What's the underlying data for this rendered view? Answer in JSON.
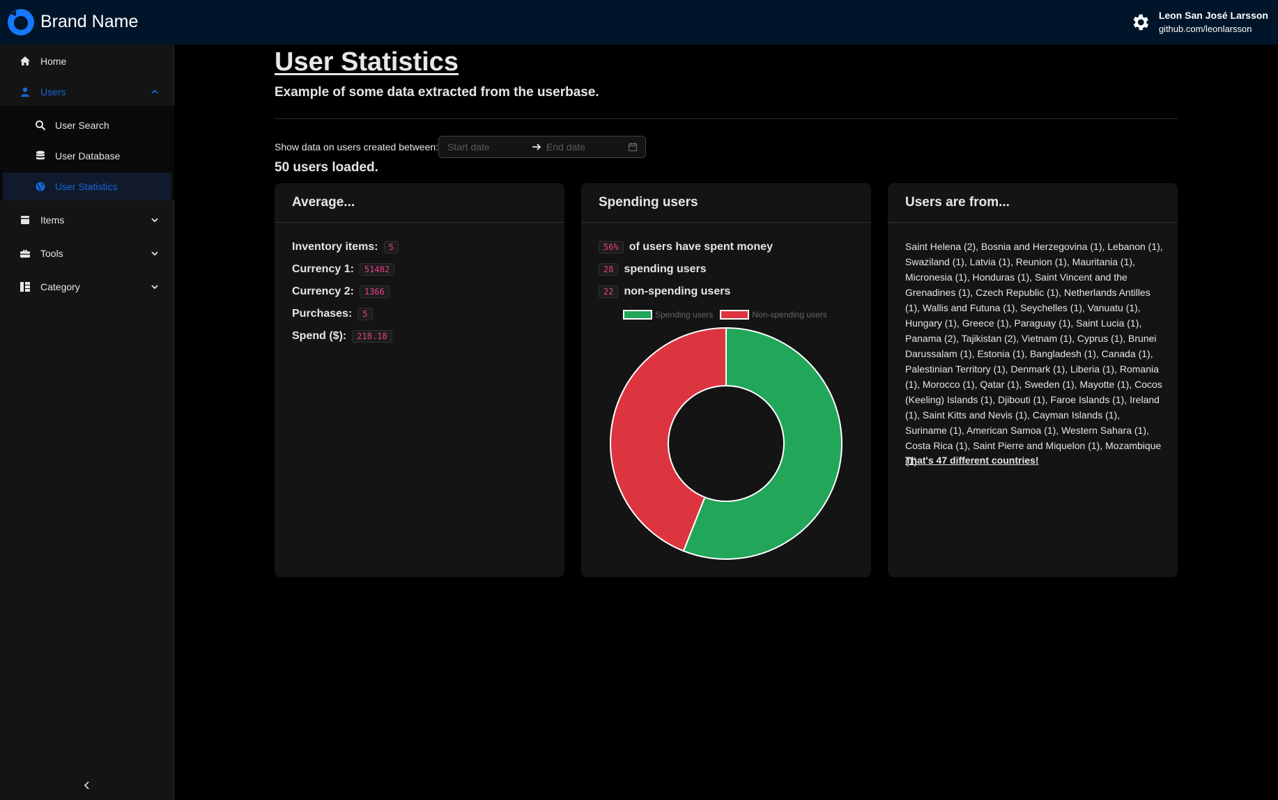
{
  "header": {
    "brand": "Brand Name",
    "user_name": "Leon San José Larsson",
    "user_link": "github.com/leonlarsson",
    "icons": {
      "logo": "circle-logo-icon",
      "settings": "gear-icon"
    }
  },
  "sidebar": {
    "items": [
      {
        "label": "Home",
        "icon": "home-icon"
      },
      {
        "label": "Users",
        "icon": "user-icon"
      },
      {
        "label": "Items",
        "icon": "box-icon"
      },
      {
        "label": "Tools",
        "icon": "toolbox-icon"
      },
      {
        "label": "Category",
        "icon": "category-icon"
      }
    ],
    "sub_items": [
      {
        "label": "User Search",
        "icon": "search-icon"
      },
      {
        "label": "User Database",
        "icon": "database-icon"
      },
      {
        "label": "User Statistics",
        "icon": "globe-icon"
      }
    ],
    "colors": {
      "accent": "#1668dc",
      "selected_bg": "#111a2c"
    }
  },
  "main": {
    "title": "User Statistics",
    "subtitle": "Example of some data extracted from the userbase.",
    "filter_label": "Show data on users created between:",
    "start_placeholder": "Start date",
    "end_placeholder": "End date",
    "loaded_text": "50 users loaded."
  },
  "average_card": {
    "title": "Average...",
    "rows": [
      {
        "label": "Inventory items:",
        "value": "5"
      },
      {
        "label": "Currency 1:",
        "value": "51482"
      },
      {
        "label": "Currency 2:",
        "value": "1366"
      },
      {
        "label": "Purchases:",
        "value": "5"
      },
      {
        "label": "Spend ($):",
        "value": "218.18"
      }
    ]
  },
  "spending_card": {
    "title": "Spending users",
    "rows": [
      {
        "value": "56%",
        "label": "of users have spent money"
      },
      {
        "value": "28",
        "label": "spending users"
      },
      {
        "value": "22",
        "label": "non-spending users"
      }
    ]
  },
  "chart_data": {
    "type": "pie",
    "categories": [
      "Spending users",
      "Non-spending users"
    ],
    "values": [
      28,
      22
    ],
    "colors": [
      "#22a65a",
      "#dc3540"
    ],
    "legend": "top"
  },
  "countries_card": {
    "title": "Users are from...",
    "list": "Saint Helena (2), Bosnia and Herzegovina (1), Lebanon (1), Swaziland (1), Latvia (1), Reunion (1), Mauritania (1), Micronesia (1), Honduras (1), Saint Vincent and the Grenadines (1), Czech Republic (1), Netherlands Antilles (1), Wallis and Futuna (1), Seychelles (1), Vanuatu (1), Hungary (1), Greece (1), Paraguay (1), Saint Lucia (1), Panama (2), Tajikistan (2), Vietnam (1), Cyprus (1), Brunei Darussalam (1), Estonia (1), Bangladesh (1), Canada (1), Palestinian Territory (1), Denmark (1), Liberia (1), Romania (1), Morocco (1), Qatar (1), Sweden (1), Mayotte (1), Cocos (Keeling) Islands (1), Djibouti (1), Faroe Islands (1), Ireland (1), Saint Kitts and Nevis (1), Cayman Islands (1), Suriname (1), American Samoa (1), Western Sahara (1), Costa Rica (1), Saint Pierre and Miquelon (1), Mozambique (1)",
    "total": "That's 47 different countries!"
  }
}
